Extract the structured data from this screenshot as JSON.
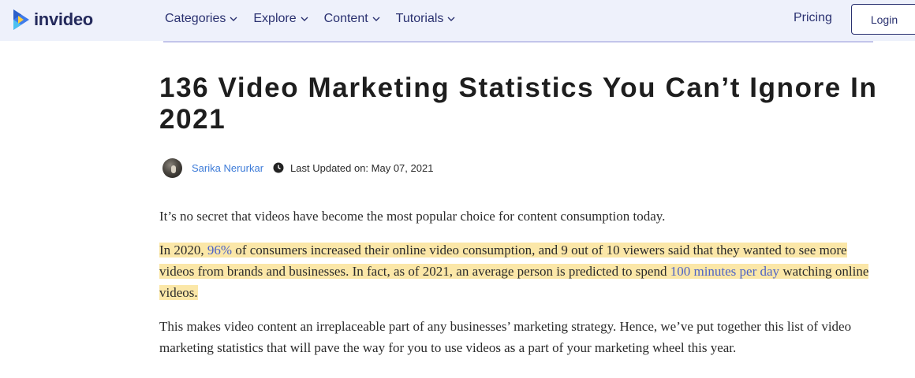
{
  "header": {
    "logo_text": "invideo",
    "nav": [
      {
        "label": "Categories"
      },
      {
        "label": "Explore"
      },
      {
        "label": "Content"
      },
      {
        "label": "Tutorials"
      }
    ],
    "pricing": "Pricing",
    "login": "Login"
  },
  "article": {
    "title": "136 Video Marketing Statistics You Can’t Ignore In 2021",
    "author": "Sarika Nerurkar",
    "updated": "Last Updated on: May 07, 2021",
    "p1": "It’s no secret that videos have become the most popular choice for content consumption today.",
    "p2": {
      "seg1": "In 2020, ",
      "link1": "96%",
      "seg2": " of consumers increased their online video consumption, and 9 out of 10 viewers said that they wanted to see more videos from brands and businesses. In fact, as of 2021,  an average person is predicted to spend ",
      "link2": "100 minutes per day",
      "seg3": " watching online videos."
    },
    "p3": "This makes video content an irreplaceable part of any businesses’ marketing strategy. Hence, we’ve put together this list of video marketing statistics that will pave the way for you to use videos as a part of your marketing wheel this year."
  },
  "colors": {
    "header_bg": "#eef1fb",
    "nav_text": "#2a3170",
    "link": "#3d7bd8",
    "highlight": "#fbe7a8"
  }
}
